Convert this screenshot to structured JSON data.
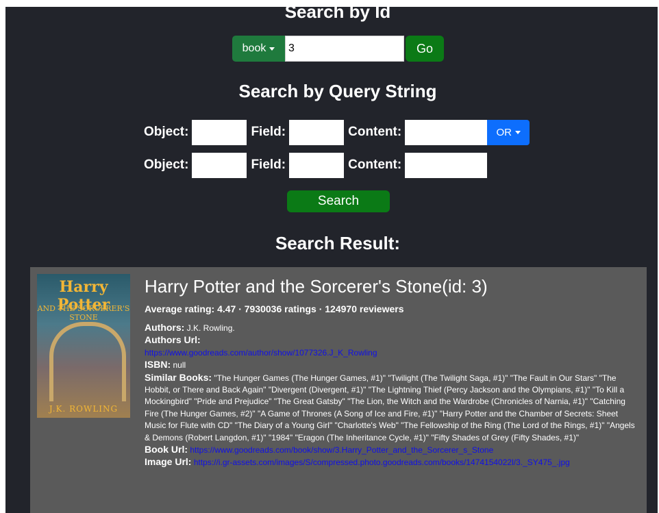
{
  "search_by_id": {
    "title": "Search by Id",
    "type_label": "book",
    "id_value": "3",
    "go_label": "Go"
  },
  "search_by_query": {
    "title": "Search by Query String",
    "object_label": "Object:",
    "field_label": "Field:",
    "content_label": "Content:",
    "operator_label": "OR",
    "search_label": "Search"
  },
  "result": {
    "title": "Search Result:",
    "book_title": "Harry Potter and the Sorcerer's Stone(id: 3)",
    "rating_line": "Average rating: 4.47 · 7930036 ratings · 124970 reviewers",
    "authors_label": "Authors:",
    "authors_value": "J.K. Rowling.",
    "authors_url_label": "Authors Url:",
    "authors_url": "https://www.goodreads.com/author/show/1077326.J_K_Rowling",
    "isbn_label": "ISBN:",
    "isbn_value": "null",
    "similar_label": "Similar Books:",
    "similar_value": "\"The Hunger Games (The Hunger Games, #1)\" \"Twilight (The Twilight Saga, #1)\" \"The Fault in Our Stars\" \"The Hobbit, or There and Back Again\" \"Divergent (Divergent, #1)\" \"The Lightning Thief (Percy Jackson and the Olympians, #1)\" \"To Kill a Mockingbird\" \"Pride and Prejudice\" \"The Great Gatsby\" \"The Lion, the Witch and the Wardrobe (Chronicles of Narnia, #1)\" \"Catching Fire (The Hunger Games, #2)\" \"A Game of Thrones (A Song of Ice and Fire, #1)\" \"Harry Potter and the Chamber of Secrets: Sheet Music for Flute with CD\" \"The Diary of a Young Girl\" \"Charlotte's Web\" \"The Fellowship of the Ring (The Lord of the Rings, #1)\" \"Angels & Demons (Robert Langdon, #1)\" \"1984\" \"Eragon (The Inheritance Cycle, #1)\" \"Fifty Shades of Grey (Fifty Shades, #1)\"",
    "book_url_label": "Book Url:",
    "book_url": "https://www.goodreads.com/book/show/3.Harry_Potter_and_the_Sorcerer_s_Stone",
    "image_url_label": "Image Url:",
    "image_url": "https://i.gr-assets.com/images/S/compressed.photo.goodreads.com/books/1474154022l/3._SY475_.jpg",
    "cover": {
      "top_text": "Harry Potter",
      "mid_text": "AND THE SORCERER'S STONE",
      "bottom_text": "J.K. ROWLING"
    }
  },
  "colors": {
    "background": "#22242b",
    "card": "#5a5a5a",
    "green_button": "#0b7a16",
    "dropdown_green": "#1f7a3d",
    "blue_button": "#0d6efd",
    "link": "#1010e8"
  }
}
